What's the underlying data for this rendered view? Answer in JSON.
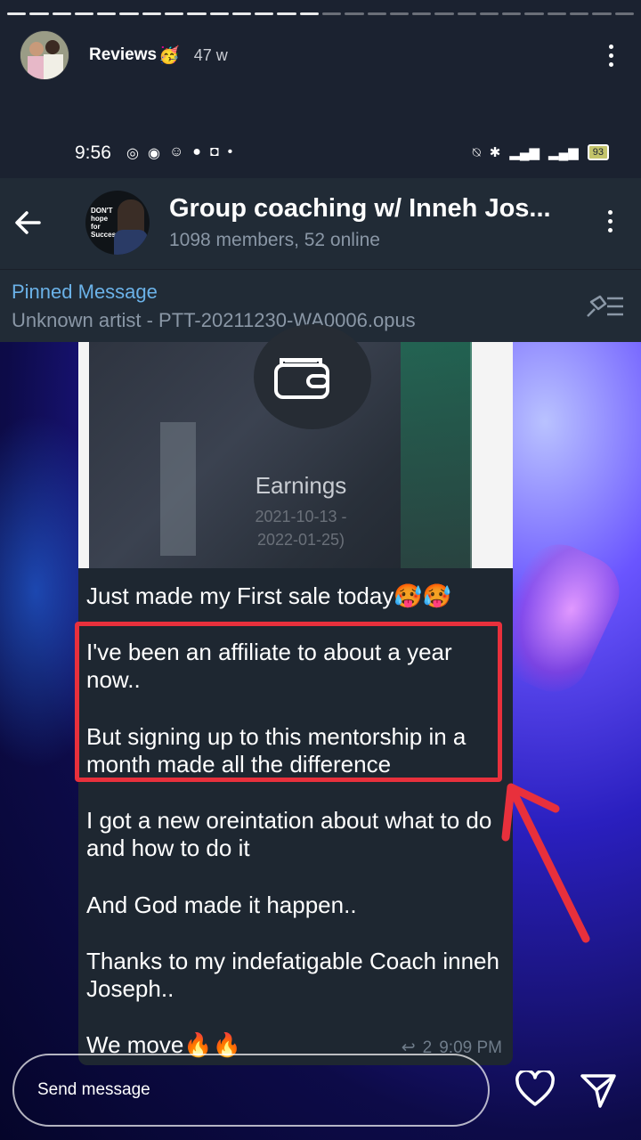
{
  "story": {
    "username": "Reviews",
    "emoji": "🥳",
    "age": "47 w",
    "progress_segments": 28,
    "progress_done": 14
  },
  "status_bar": {
    "time": "9:56",
    "battery": "93"
  },
  "chat": {
    "title": "Group coaching w/ Inneh Jos...",
    "subtitle": "1098 members, 52 online",
    "avatar_text": "DON'T hope for Success"
  },
  "pinned": {
    "label": "Pinned Message",
    "text": "Unknown artist - PTT-20211230-WA0006.opus"
  },
  "media": {
    "title": "Earnings",
    "date_line1": "2021-10-13 -",
    "date_line2": "2022-01-25)"
  },
  "message": {
    "line1": "Just made my First sale today🥵🥵",
    "para1": "I've been an affiliate to about a year now..",
    "para2": "But signing up to this mentorship in a month made all the difference",
    "para3": "I got a new oreintation about what to do and how to do it",
    "para4": "And God made it happen..",
    "para5": "Thanks to my indefatigable Coach inneh Joseph..",
    "para6": "We move🔥🔥",
    "replies": "2",
    "time": "9:09 PM"
  },
  "footer": {
    "send_placeholder": "Send message"
  },
  "colors": {
    "highlight": "#e8303c",
    "pinned_label": "#6bb2e8"
  }
}
